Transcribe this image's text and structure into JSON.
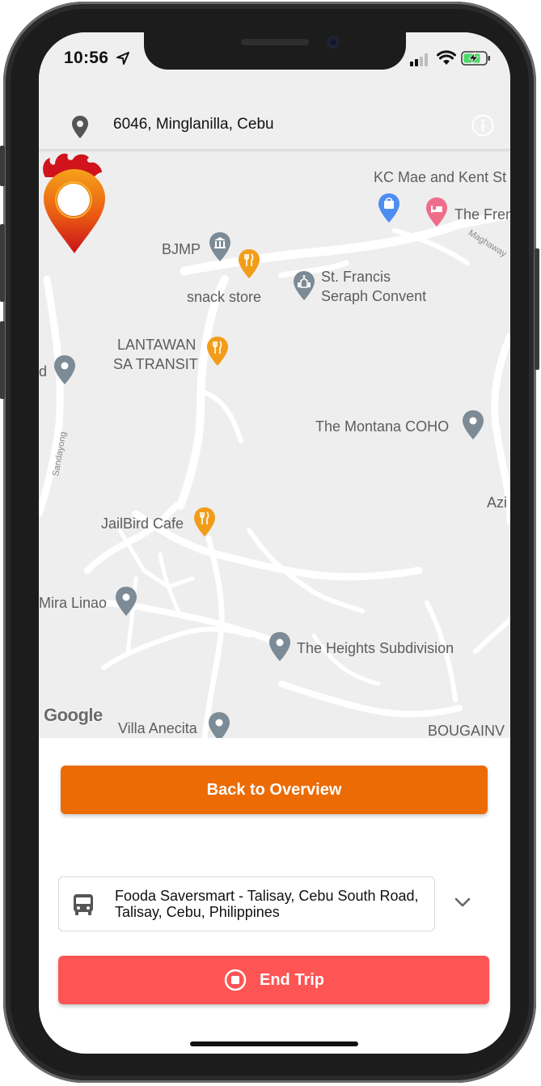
{
  "status_bar": {
    "time": "10:56",
    "icons": [
      "location-arrow-icon",
      "cellular-signal-icon",
      "wifi-icon",
      "battery-charging-icon"
    ]
  },
  "header": {
    "address": "6046, Minglanilla, Cebu",
    "pin_icon": "map-pin-icon",
    "info_icon": "info-icon"
  },
  "map": {
    "attribution": "Google",
    "labels": {
      "kc_mae": "KC Mae and Kent St",
      "the_fren": "The Fren",
      "maghaway": "Maghaway",
      "bjmp": "BJMP",
      "st_francis_1": "St. Francis",
      "st_francis_2": "Seraph Convent",
      "snack_store": "snack store",
      "lantawan_1": "LANTAWAN",
      "lantawan_2": "SA TRANSIT",
      "d_partial": "d",
      "montana": "The Montana COHO",
      "sandayong": "Sandayong",
      "azi": "Azi",
      "jailbird": "JailBird Cafe",
      "mira_linao": "Mira Linao",
      "heights": "The Heights Subdivision",
      "villa_anecita": "Villa Anecita",
      "bougainv": "BOUGAINV"
    },
    "colors": {
      "background": "#eeeeee",
      "road": "#ffffff",
      "poi_gray": "#7c8b96",
      "poi_food": "#f29d1a",
      "poi_shop": "#4d8ef2",
      "poi_hotel": "#ee6d8b"
    }
  },
  "actions": {
    "back_to_overview": "Back to Overview",
    "end_trip": "End Trip"
  },
  "destination": {
    "text": "Fooda Saversmart - Talisay, Cebu South Road, Talisay, Cebu, Philippines",
    "icon": "bus-icon"
  },
  "theme": {
    "primary_orange": "#ec6b05",
    "danger_red": "#fc5554"
  }
}
